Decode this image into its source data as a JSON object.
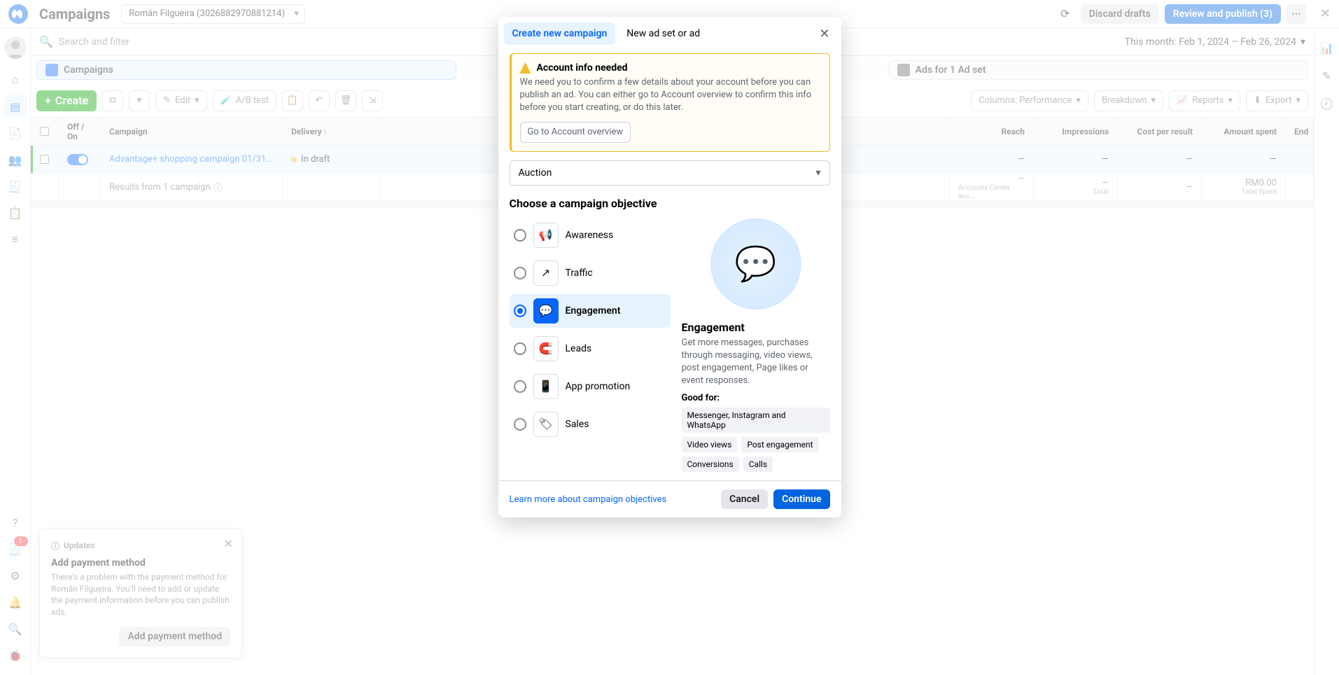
{
  "header": {
    "page_title": "Campaigns",
    "account": "Román Filgueira (3026882970881214)",
    "discard": "Discard drafts",
    "review": "Review and publish (3)"
  },
  "search": {
    "placeholder": "Search and filter"
  },
  "date_range": "This month: Feb 1, 2024 – Feb 26, 2024",
  "tabs": {
    "campaigns": "Campaigns",
    "ads": "Ads for 1 Ad set"
  },
  "actions": {
    "create": "Create",
    "edit": "Edit",
    "ab": "A/B test",
    "columns": "Columns: Performance",
    "breakdown": "Breakdown",
    "reports": "Reports",
    "export": "Export"
  },
  "columns": {
    "off_on": "Off / On",
    "campaign": "Campaign",
    "delivery": "Delivery",
    "reach": "Reach",
    "impressions": "Impressions",
    "cost": "Cost per result",
    "spent": "Amount spent",
    "end": "End"
  },
  "rows": [
    {
      "name": "Advantage+ shopping campaign 01/31/2024 ...",
      "delivery": "In draft",
      "reach": "—",
      "impressions": "—",
      "cost": "—",
      "spent": "—"
    }
  ],
  "results": {
    "label": "Results from 1 campaign",
    "reach": {
      "val": "—",
      "sub": "Accounts Center acc..."
    },
    "impressions": {
      "val": "—",
      "sub": "Total"
    },
    "cost": {
      "val": "—",
      "sub": ""
    },
    "spent": {
      "val": "RM0.00",
      "sub": "Total Spent"
    }
  },
  "updates": {
    "badge": "Updates",
    "title": "Add payment method",
    "body": "There's a problem with the payment method for Román Filgueira. You'll need to add or update the payment information before you can publish ads.",
    "btn": "Add payment method"
  },
  "modal": {
    "tab1": "Create new campaign",
    "tab2": "New ad set or ad",
    "alert": {
      "title": "Account info needed",
      "body": "We need you to confirm a few details about your account before you can publish an ad. You can either go to Account overview to confirm this info before you start creating, or do this later.",
      "btn": "Go to Account overview"
    },
    "buying_type": "Auction",
    "objective_h": "Choose a campaign objective",
    "objectives": [
      "Awareness",
      "Traffic",
      "Engagement",
      "Leads",
      "App promotion",
      "Sales"
    ],
    "selected": 2,
    "detail": {
      "title": "Engagement",
      "desc": "Get more messages, purchases through messaging, video views, post engagement, Page likes or event responses.",
      "good_for": "Good for:",
      "chips": [
        "Messenger, Instagram and WhatsApp",
        "Video views",
        "Post engagement",
        "Conversions",
        "Calls"
      ]
    },
    "learn": "Learn more about campaign objectives",
    "cancel": "Cancel",
    "continue": "Continue"
  },
  "left_badge": "1"
}
